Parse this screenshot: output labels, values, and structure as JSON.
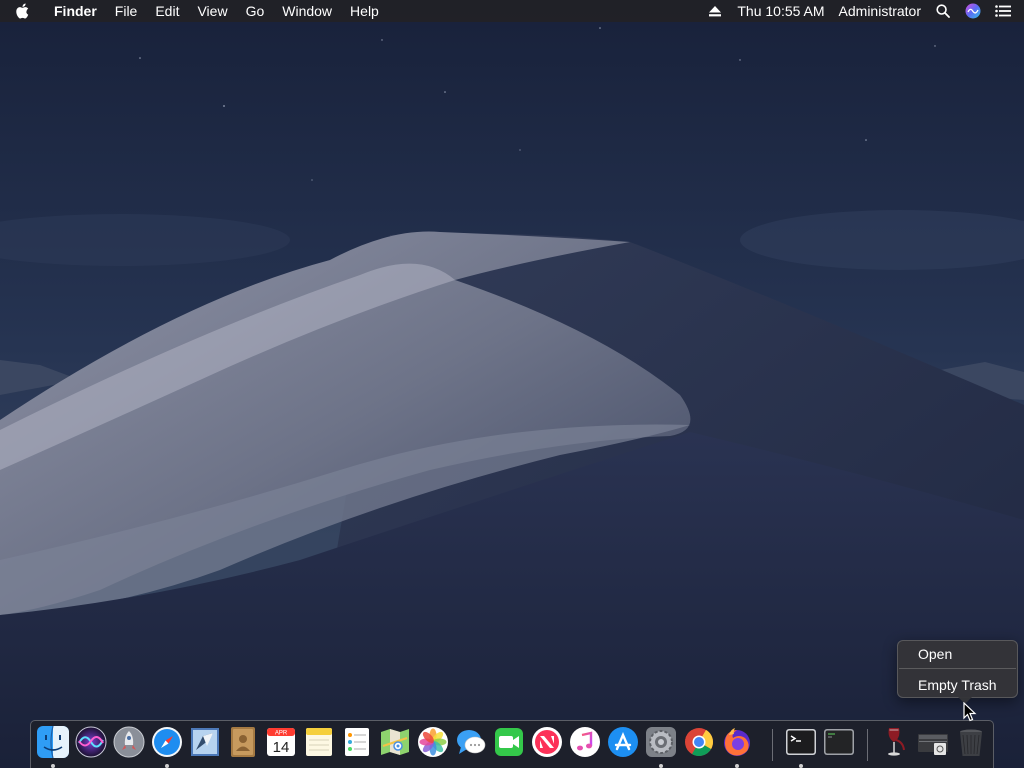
{
  "menubar": {
    "app_name": "Finder",
    "menus": [
      "File",
      "Edit",
      "View",
      "Go",
      "Window",
      "Help"
    ],
    "clock": "Thu 10:55 AM",
    "user": "Administrator",
    "icons": [
      "apple-icon",
      "eject-icon",
      "spotlight-search-icon",
      "siri-icon",
      "notification-center-icon"
    ]
  },
  "context_menu": {
    "items": [
      "Open",
      "Empty Trash"
    ]
  },
  "dock": {
    "apps": [
      {
        "name": "Finder",
        "icon": "finder-icon",
        "running": true
      },
      {
        "name": "Siri",
        "icon": "siri-icon",
        "running": false
      },
      {
        "name": "Launchpad",
        "icon": "launchpad-icon",
        "running": false
      },
      {
        "name": "Safari",
        "icon": "safari-icon",
        "running": true
      },
      {
        "name": "Mail",
        "icon": "mail-icon",
        "running": false
      },
      {
        "name": "Contacts",
        "icon": "contacts-icon",
        "running": false
      },
      {
        "name": "Calendar",
        "icon": "calendar-icon",
        "running": false,
        "badge_month": "APR",
        "badge_day": "14"
      },
      {
        "name": "Notes",
        "icon": "notes-icon",
        "running": false
      },
      {
        "name": "Reminders",
        "icon": "reminders-icon",
        "running": false
      },
      {
        "name": "Maps",
        "icon": "maps-icon",
        "running": false
      },
      {
        "name": "Photos",
        "icon": "photos-icon",
        "running": false
      },
      {
        "name": "Messages",
        "icon": "messages-icon",
        "running": false
      },
      {
        "name": "FaceTime",
        "icon": "facetime-icon",
        "running": false
      },
      {
        "name": "News",
        "icon": "news-icon",
        "running": false
      },
      {
        "name": "iTunes",
        "icon": "itunes-icon",
        "running": false
      },
      {
        "name": "App Store",
        "icon": "app-store-icon",
        "running": false
      },
      {
        "name": "System Preferences",
        "icon": "system-preferences-icon",
        "running": true
      },
      {
        "name": "Chrome",
        "icon": "chrome-icon",
        "running": false
      },
      {
        "name": "Firefox",
        "icon": "firefox-icon",
        "running": true
      },
      {
        "name": "Terminal",
        "icon": "terminal-icon",
        "running": true
      },
      {
        "name": "Console",
        "icon": "console-icon",
        "running": false
      },
      {
        "name": "Wine",
        "icon": "wine-icon",
        "running": false
      },
      {
        "name": "Downloads",
        "icon": "downloads-stack-icon",
        "running": false
      },
      {
        "name": "Trash",
        "icon": "trash-icon",
        "running": false
      }
    ]
  },
  "colors": {
    "menubar_bg": "#222226",
    "sky_top": "#1a2236",
    "dune_light": "#a9acbc",
    "dune_shadow": "#2b3450"
  }
}
